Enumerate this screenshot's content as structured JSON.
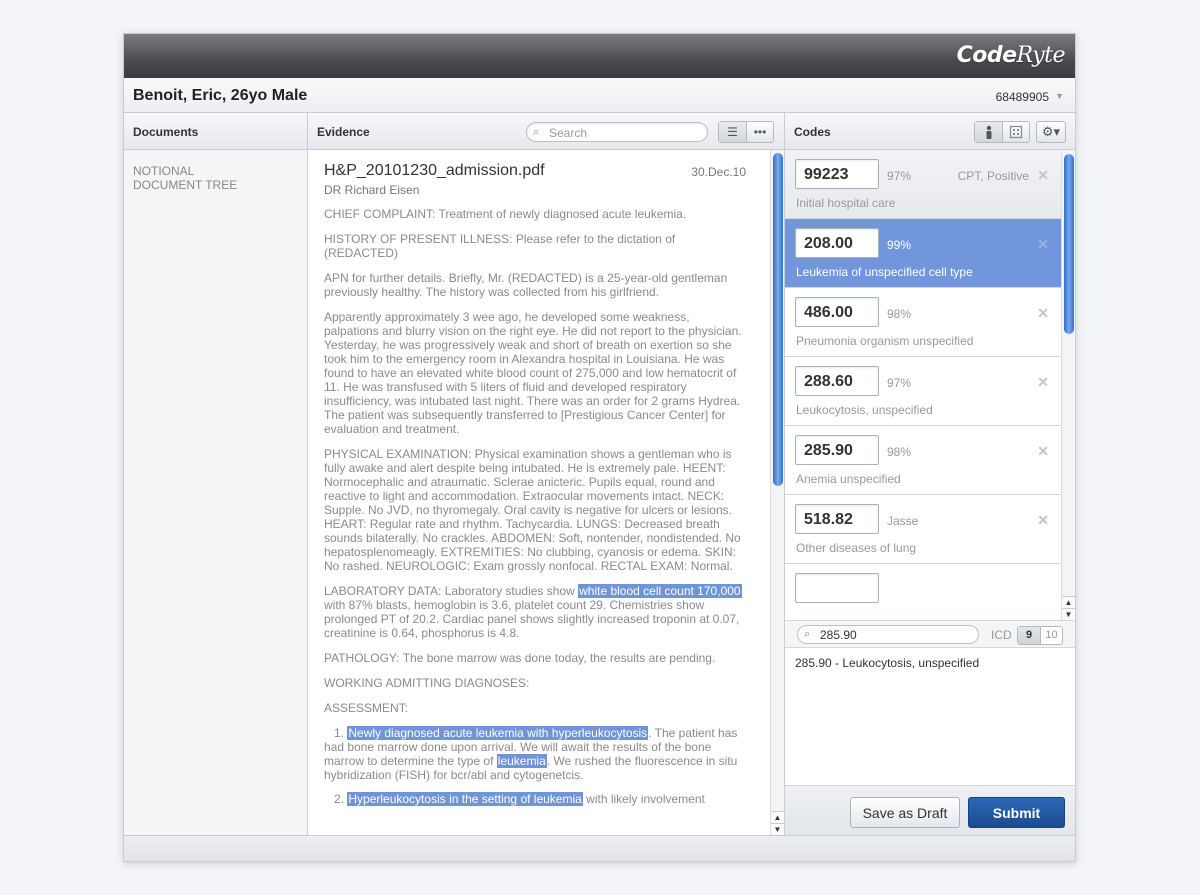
{
  "app": {
    "logo_bold": "Code",
    "logo_thin": "Ryte"
  },
  "patient": {
    "name": "Benoit, Eric, 26yo Male",
    "id": "68489905"
  },
  "columns": {
    "documents": "Documents",
    "evidence": "Evidence",
    "codes": "Codes"
  },
  "search": {
    "placeholder": "Search"
  },
  "documents": {
    "tree_label": "NOTIONAL DOCUMENT TREE"
  },
  "document": {
    "title": "H&P_20101230_admission.pdf",
    "date": "30.Dec.10",
    "author": "DR Richard Eisen",
    "paragraphs": {
      "p1": "CHIEF COMPLAINT: Treatment of newly diagnosed acute leukemia.",
      "p2": "HISTORY OF PRESENT ILLNESS: Please refer to the dictation of (REDACTED)",
      "p3": "APN for further details.  Briefly, Mr. (REDACTED) is a 25-year-old gentleman previously healthy. The history was collected from his girlfriend.",
      "p4": "Apparently approximately 3 wee ago, he developed some weakness, palpations and blurry vision on the right eye.  He did not report to the physician. Yesterday, he was progressively weak and short of breath on exertion so she took him to the emergency room in Alexandra hospital in Louisiana. He was found to have an elevated white blood count of 275,000 and low hematocrit of 11. He was transfused with 5 liters of fluid and developed respiratory insufficiency, was intubated last night. There was an order for 2 grams Hydrea. The patient was subsequently transferred to [Prestigious Cancer Center] for evaluation and treatment.",
      "p5": "PHYSICAL EXAMINATION: Physical examination shows a gentleman who is fully awake and alert despite being intubated. He is extremely pale. HEENT: Normocephalic and atraumatic. Sclerae anicteric. Pupils equal, round and reactive to light and accommodation. Extraocular movements intact. NECK: Supple. No JVD, no thyromegaly. Oral cavity is negative for ulcers or lesions. HEART: Regular rate and rhythm. Tachycardia. LUNGS:  Decreased breath sounds bilaterally. No crackles. ABDOMEN: Soft, nontender, nondistended. No hepatosplenomeagly. EXTREMITIES: No clubbing, cyanosis or edema. SKIN: No rashed.  NEUROLOGIC: Exam grossly nonfocal. RECTAL EXAM: Normal.",
      "p6a": "LABORATORY DATA: Laboratory studies show ",
      "p6hl": "white blood cell count 170,000",
      "p6b": " with 87% blasts, hemoglobin is 3.6, platelet count 29. Chemistries show prolonged PT of 20.2. Cardiac panel shows slightly increased troponin at 0.07, creatinine is 0.64, phosphorus is 4.8.",
      "p7": "PATHOLOGY:  The bone marrow was done today, the results are pending.",
      "p8": "WORKING ADMITTING DIAGNOSES:",
      "p9": "ASSESSMENT:",
      "li1num": "1. ",
      "li1hl": "Newly diagnosed acute leukemia with hyperleukocytosis",
      "li1a": ". The patient has had bone marrow done upon arrival. We will await the results of the bone marrow to determine the type of ",
      "li1hl2": "leukemia",
      "li1b": ". We rushed the fluorescence in situ hybridization (FISH) for bcr/abl and cytogenetcis.",
      "li2num": "2. ",
      "li2hl": "Hyperleukocytosis in the setting of leukemia",
      "li2a": " with likely involvement"
    }
  },
  "codes": [
    {
      "code": "99223",
      "pct": "97%",
      "tag": "CPT, Positive",
      "desc": "Initial hospital care"
    },
    {
      "code": "208.00",
      "pct": "99%",
      "tag": "",
      "desc": "Leukemia of unspecified cell type"
    },
    {
      "code": "486.00",
      "pct": "98%",
      "tag": "",
      "desc": "Pneumonia organism unspecified"
    },
    {
      "code": "288.60",
      "pct": "97%",
      "tag": "",
      "desc": "Leukocytosis, unspecified"
    },
    {
      "code": "285.90",
      "pct": "98%",
      "tag": "",
      "desc": "Anemia unspecified"
    },
    {
      "code": "518.82",
      "pct": "Jasse",
      "tag": "",
      "desc": "Other diseases of lung"
    }
  ],
  "lookup": {
    "value": "285.90",
    "icd_label": "ICD",
    "icd_options": [
      "9",
      "10"
    ],
    "result": "285.90 - Leukocytosis, unspecified"
  },
  "actions": {
    "draft": "Save as Draft",
    "submit": "Submit"
  },
  "icons": {
    "search": "search-icon",
    "list": "list-view-icon",
    "more": "more-icon",
    "person": "person-icon",
    "building": "building-icon",
    "gear": "gear-icon",
    "remove": "close-icon"
  },
  "colors": {
    "selection": "#7196dc",
    "highlight": "#6f95d8",
    "submit": "#1a4c92",
    "scroll_thumb": "#2f6fcf"
  }
}
